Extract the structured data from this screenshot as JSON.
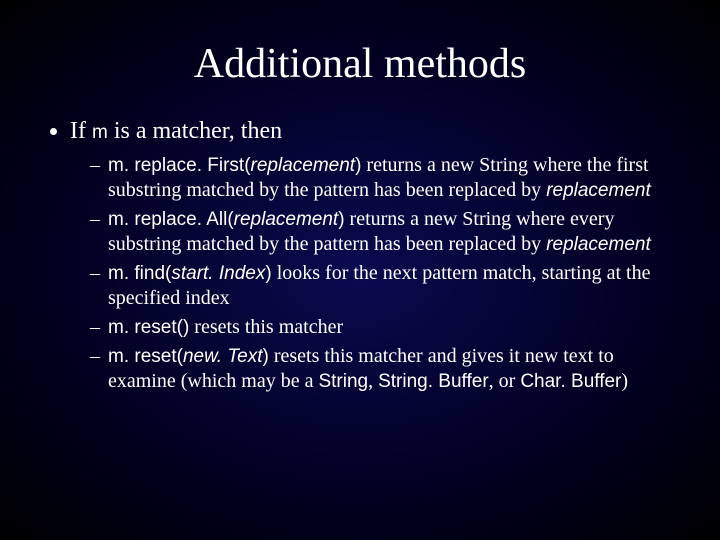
{
  "title": "Additional methods",
  "top_bullet_prefix": "If ",
  "top_bullet_code": "m",
  "top_bullet_suffix": " is a matcher, then",
  "items": [
    {
      "code_pre": "m. replace. First(",
      "param": "replacement",
      "code_post": ")",
      "desc_pre": " returns a new String where the first substring matched by the pattern has been replaced by ",
      "desc_param": "replacement",
      "desc_post": ""
    },
    {
      "code_pre": "m. replace. All(",
      "param": "replacement",
      "code_post": ")",
      "desc_pre": " returns a new String where every substring matched by the pattern has been replaced by ",
      "desc_param": "replacement",
      "desc_post": ""
    },
    {
      "code_pre": "m. find(",
      "param": "start. Index",
      "code_post": ")",
      "desc_pre": " looks for the next pattern match, starting at the specified index",
      "desc_param": "",
      "desc_post": ""
    },
    {
      "code_pre": "m. reset()",
      "param": "",
      "code_post": "",
      "desc_pre": " resets this matcher",
      "desc_param": "",
      "desc_post": ""
    },
    {
      "code_pre": "m. reset(",
      "param": "new. Text",
      "code_post": ")",
      "desc_pre": " resets this matcher and gives it new text to examine (which may be a ",
      "desc_param": "",
      "desc_post": "",
      "trail_code1": "String",
      "trail_mid1": ", ",
      "trail_code2": "String. Buffer",
      "trail_mid2": ", or ",
      "trail_code3": "Char. Buffer",
      "trail_end": ")"
    }
  ]
}
